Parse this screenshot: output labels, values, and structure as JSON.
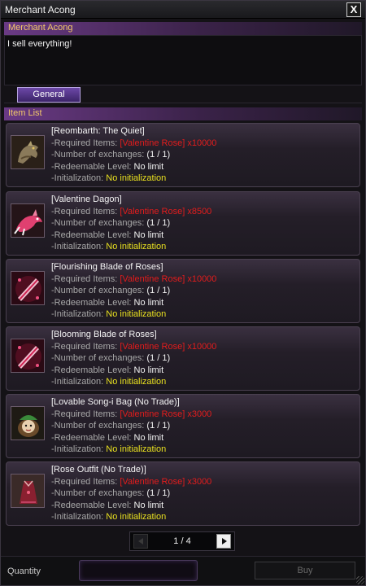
{
  "window": {
    "title": "Merchant Acong",
    "close_label": "X"
  },
  "npc": {
    "name": "Merchant Acong",
    "greeting": "I sell everything!"
  },
  "tabs": [
    {
      "label": "General",
      "active": true
    }
  ],
  "item_list_label": "Item List",
  "field_labels": {
    "required": "-Required Items:",
    "exchanges": "-Number of exchanges:",
    "level": "-Redeemable Level:",
    "init": "-Initialization:"
  },
  "items": [
    {
      "name": "[Reombarth: The Quiet]",
      "required": "[Valentine Rose] x10000",
      "exchanges": "(1 / 1)",
      "level": "No limit",
      "init": "No initialization",
      "icon": "dragon-statue-icon"
    },
    {
      "name": "[Valentine Dagon]",
      "required": "[Valentine Rose] x8500",
      "exchanges": "(1 / 1)",
      "level": "No limit",
      "init": "No initialization",
      "icon": "pink-dragon-mount-icon"
    },
    {
      "name": "[Flourishing Blade of Roses]",
      "required": "[Valentine Rose] x10000",
      "exchanges": "(1 / 1)",
      "level": "No limit",
      "init": "No initialization",
      "icon": "rose-blade-icon"
    },
    {
      "name": "[Blooming Blade of Roses]",
      "required": "[Valentine Rose] x10000",
      "exchanges": "(1 / 1)",
      "level": "No limit",
      "init": "No initialization",
      "icon": "rose-blade-icon"
    },
    {
      "name": "[Lovable Song-i Bag (No Trade)]",
      "required": "[Valentine Rose] x3000",
      "exchanges": "(1 / 1)",
      "level": "No limit",
      "init": "No initialization",
      "icon": "song-i-bag-icon"
    },
    {
      "name": "[Rose Outfit (No Trade)]",
      "required": "[Valentine Rose] x3000",
      "exchanges": "(1 / 1)",
      "level": "No limit",
      "init": "No initialization",
      "icon": "rose-outfit-icon"
    }
  ],
  "pagination": {
    "text": "1 / 4",
    "current": 1,
    "total": 4
  },
  "footer": {
    "quantity_label": "Quantity",
    "quantity_value": "",
    "buy_label": "Buy"
  }
}
